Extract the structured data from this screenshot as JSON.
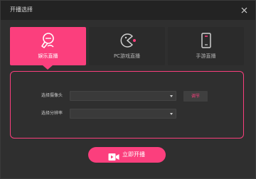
{
  "window": {
    "title": "开播选择",
    "close_icon": "close-icon"
  },
  "tabs": [
    {
      "label": "娱乐直播",
      "icon": "microphone-icon",
      "active": true
    },
    {
      "label": "PC游戏直播",
      "icon": "pacman-icon",
      "active": false
    },
    {
      "label": "手游直播",
      "icon": "mobile-phone-icon",
      "active": false
    }
  ],
  "settings": {
    "camera_label": "选择摄像头",
    "camera_value": "",
    "debug_label": "调节",
    "resolution_label": "选择分辨率",
    "resolution_value": ""
  },
  "start": {
    "label": "立即开播",
    "icon": "video-camera-icon"
  },
  "colors": {
    "accent": "#fb3f7d",
    "background": "#2f2f2f",
    "titlebar": "#232323"
  }
}
